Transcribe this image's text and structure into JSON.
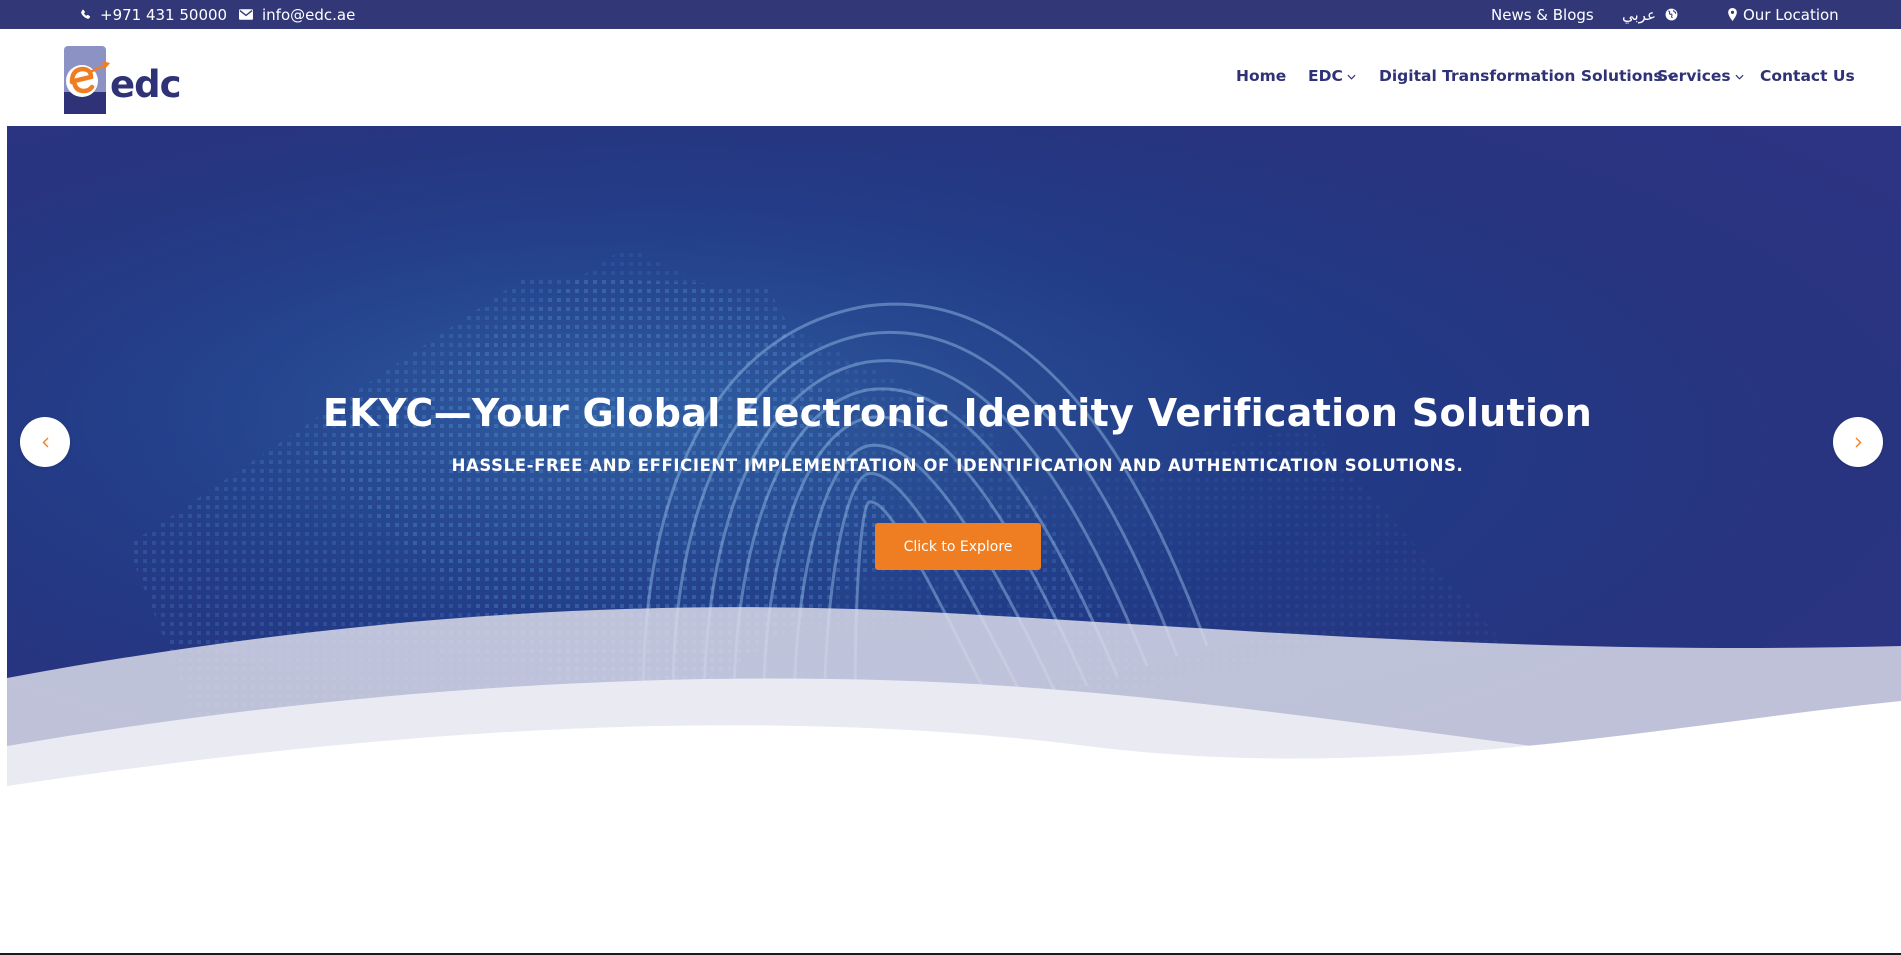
{
  "topbar": {
    "phone": "+971 431 50000",
    "email": "info@edc.ae",
    "news": "News & Blogs",
    "arabic": "عربي",
    "location": "Our Location",
    "icons": [
      "phone-icon",
      "envelope-icon",
      "globe-icon",
      "map-pin-icon"
    ]
  },
  "logo": {
    "text": "edc"
  },
  "nav": {
    "home": "Home",
    "edc": "EDC",
    "dts": "Digital Transformation Solutions",
    "services": "Services",
    "contact": "Contact Us"
  },
  "hero": {
    "title": "EKYC—Your Global Electronic Identity Verification Solution",
    "subtitle": "HASSLE-FREE AND EFFICIENT IMPLEMENTATION OF IDENTIFICATION AND AUTHENTICATION SOLUTIONS.",
    "button": "Click to Explore",
    "prev_icon": "chevron-left-icon",
    "next_icon": "chevron-right-icon"
  },
  "colors": {
    "topbar": "#323877",
    "brand_navy": "#2f3276",
    "accent_orange": "#ef7d22",
    "hero_blue": "#213a86"
  }
}
